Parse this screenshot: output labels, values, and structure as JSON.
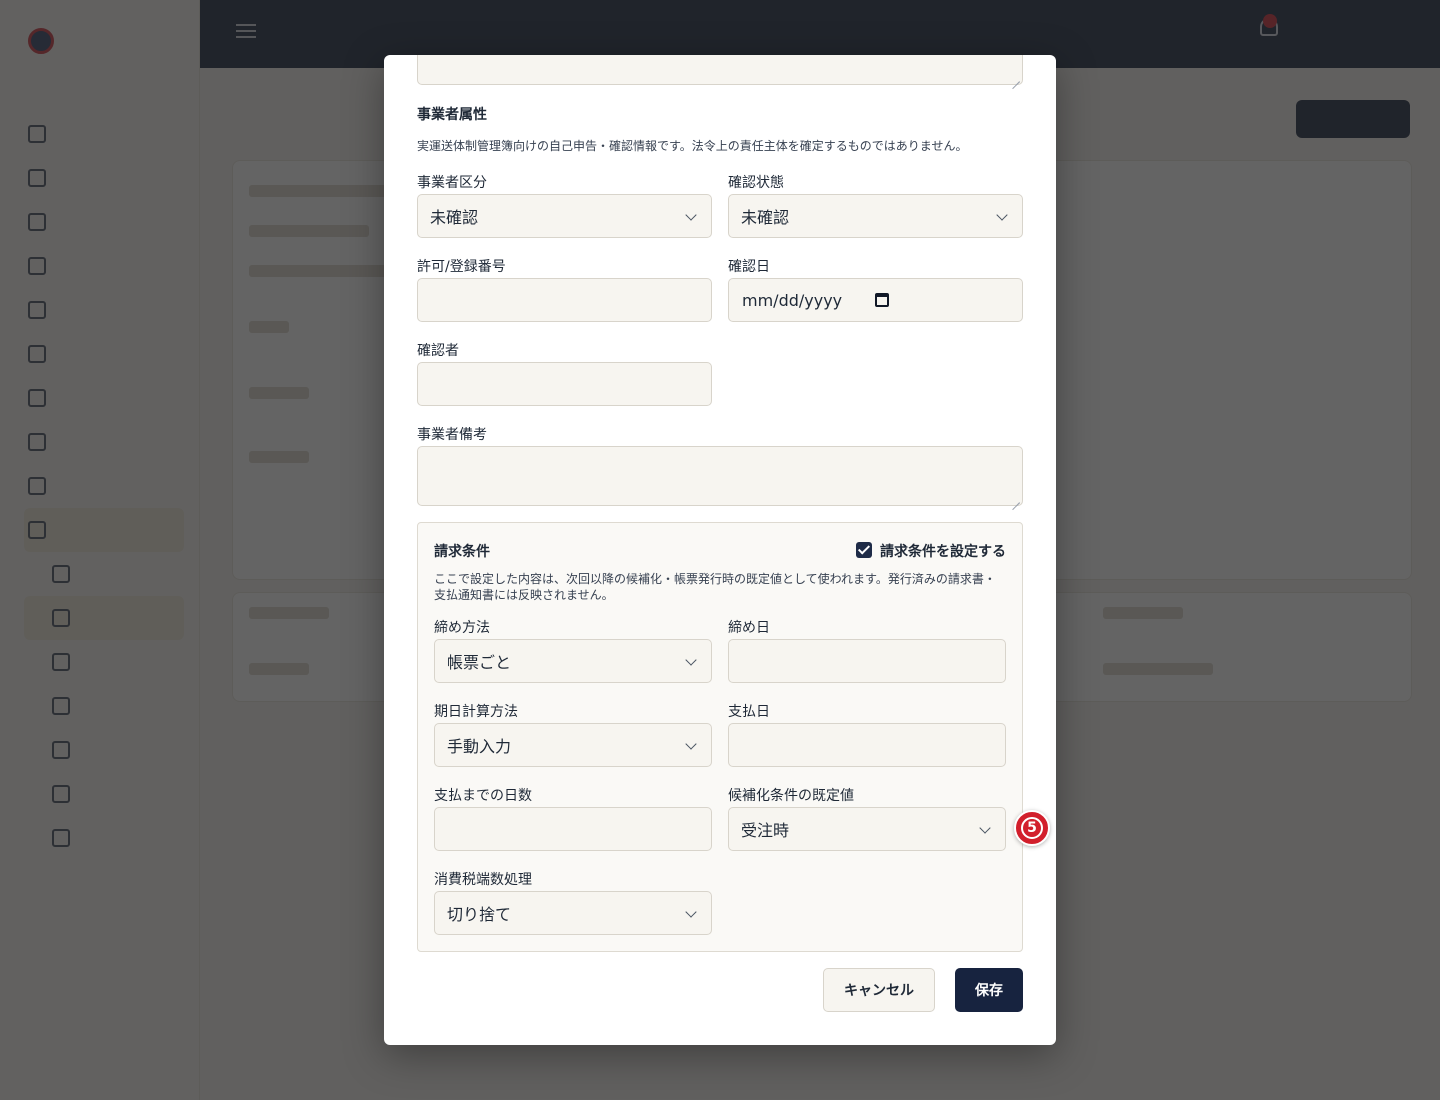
{
  "modal": {
    "operator_section": {
      "title": "事業者属性",
      "help": "実運送体制管理簿向けの自己申告・確認情報です。法令上の責任主体を確定するものではありません。",
      "operator_type": {
        "label": "事業者区分",
        "value": "未確認"
      },
      "confirm_status": {
        "label": "確認状態",
        "value": "未確認"
      },
      "permit_number": {
        "label": "許可/登録番号",
        "value": ""
      },
      "confirm_date": {
        "label": "確認日",
        "placeholder": "mm/dd/yyyy"
      },
      "confirmer": {
        "label": "確認者",
        "value": ""
      },
      "operator_notes": {
        "label": "事業者備考",
        "value": ""
      }
    },
    "billing_section": {
      "title": "請求条件",
      "checkbox_label": "請求条件を設定する",
      "checkbox_checked": true,
      "help_line1": "ここで設定した内容は、次回以降の候補化・帳票発行時の既定値として使われます。発行済みの請求書・",
      "help_line2": "支払通知書には反映されません。",
      "closing_method": {
        "label": "締め方法",
        "value": "帳票ごと"
      },
      "closing_day": {
        "label": "締め日",
        "value": ""
      },
      "due_calc_method": {
        "label": "期日計算方法",
        "value": "手動入力"
      },
      "payment_day": {
        "label": "支払日",
        "value": ""
      },
      "days_until_payment": {
        "label": "支払までの日数",
        "value": ""
      },
      "candidate_default": {
        "label": "候補化条件の既定値",
        "value": "受注時"
      },
      "tax_rounding": {
        "label": "消費税端数処理",
        "value": "切り捨て"
      }
    },
    "buttons": {
      "cancel": "キャンセル",
      "save": "保存"
    }
  },
  "step_marker": "5",
  "colors": {
    "primary": "#17233f",
    "marker": "#d21f2c",
    "field_bg": "#f7f5f0"
  }
}
